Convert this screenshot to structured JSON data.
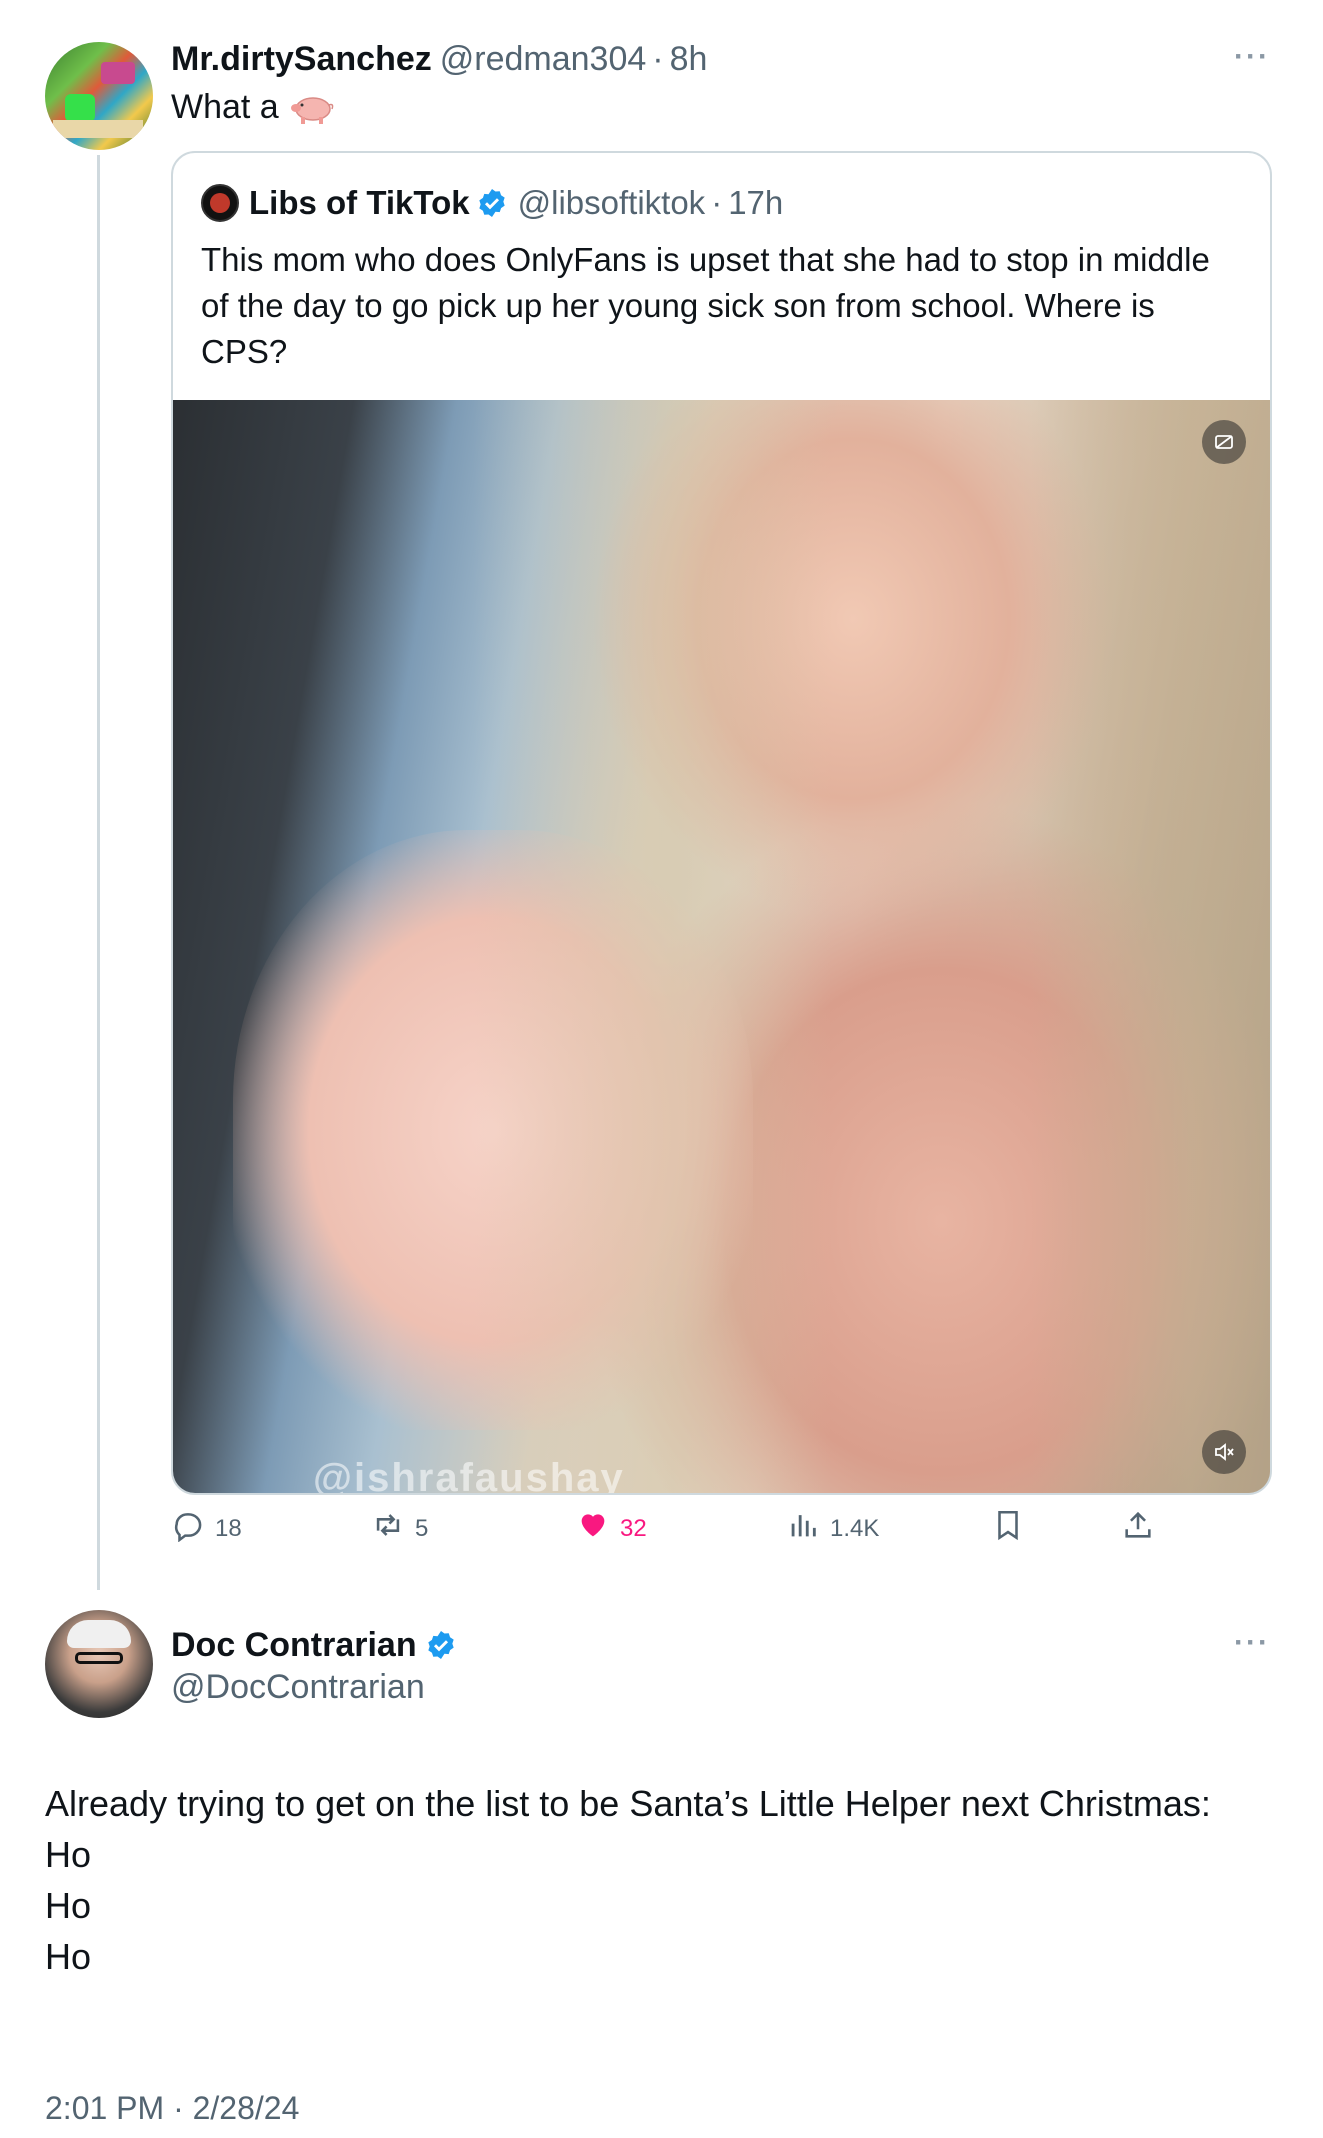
{
  "colors": {
    "like": "#f91880",
    "verified": "#1d9bf0",
    "muted": "#536471"
  },
  "reply_tweet": {
    "display_name": "Mr.dirtySanchez",
    "handle": "@redman304",
    "separator": "·",
    "time": "8h",
    "text": "What a",
    "emoji_icon": "pig-icon",
    "more": "···"
  },
  "quoted_tweet": {
    "display_name": "Libs of TikTok",
    "handle": "@libsoftiktok",
    "separator": "·",
    "time": "17h",
    "text": "This mom who does OnlyFans is upset that she had to stop in middle of the day to go pick up her young sick son from school. Where is CPS?",
    "watermark": "@ishrafaushay"
  },
  "actions": {
    "replies": "18",
    "reposts": "5",
    "likes": "32",
    "views": "1.4K"
  },
  "main_tweet": {
    "display_name": "Doc Contrarian",
    "handle": "@DocContrarian",
    "more": "···",
    "lines": [
      "Already trying to get on the list to be Santa’s Little Helper next Christmas:",
      "Ho",
      "Ho",
      "Ho"
    ],
    "timestamp": "2:01 PM · 2/28/24"
  }
}
